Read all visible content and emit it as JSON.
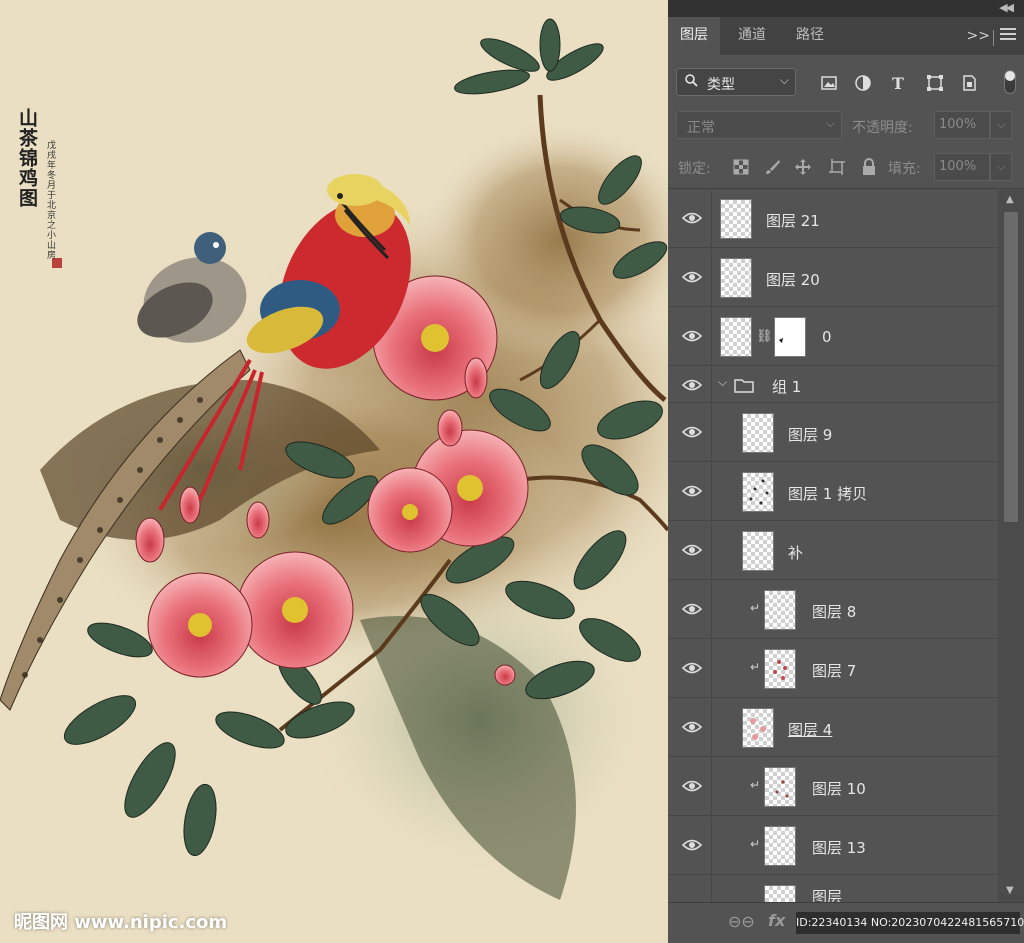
{
  "artwork": {
    "poem_title": "山茶锦鸡图",
    "poem_line": "戊戌年冬月于北京之小山房",
    "watermark": "昵图网 www.nipic.com"
  },
  "panel": {
    "tabs": [
      {
        "label": "图层",
        "active": true
      },
      {
        "label": "通道",
        "active": false
      },
      {
        "label": "路径",
        "active": false
      }
    ],
    "expand_icon": "double-chevron-right-icon",
    "menu_icon": "hamburger-menu-icon",
    "filter": {
      "label": "类型",
      "icons": [
        "image-filter-icon",
        "adjustment-filter-icon",
        "type-filter-icon",
        "shape-filter-icon",
        "smart-object-filter-icon"
      ]
    },
    "blend": {
      "mode": "正常",
      "opacity_label": "不透明度:",
      "opacity_value": "100%"
    },
    "lock": {
      "label": "锁定:",
      "icons": [
        "lock-transparent-icon",
        "lock-paint-icon",
        "lock-move-icon",
        "lock-artboard-icon",
        "lock-all-icon"
      ],
      "fill_label": "填充:",
      "fill_value": "100%"
    },
    "layers": [
      {
        "name": "图层 21",
        "indent": 0,
        "kind": "layer"
      },
      {
        "name": "图层 20",
        "indent": 0,
        "kind": "layer"
      },
      {
        "name": "0",
        "indent": 0,
        "kind": "masked"
      },
      {
        "name": "组 1",
        "indent": 0,
        "kind": "group"
      },
      {
        "name": "图层 9",
        "indent": 1,
        "kind": "layer"
      },
      {
        "name": "图层 1 拷贝",
        "indent": 1,
        "kind": "layer"
      },
      {
        "name": "补",
        "indent": 1,
        "kind": "layer"
      },
      {
        "name": "图层 8",
        "indent": 2,
        "kind": "clipped"
      },
      {
        "name": "图层 7",
        "indent": 2,
        "kind": "clipped"
      },
      {
        "name": "图层 4",
        "indent": 1,
        "kind": "layer"
      },
      {
        "name": "图层 10",
        "indent": 2,
        "kind": "clipped"
      },
      {
        "name": "图层 13",
        "indent": 2,
        "kind": "clipped"
      },
      {
        "name": "图层",
        "indent": 2,
        "kind": "clipped"
      }
    ],
    "bottom": {
      "link_icon": "link-layers-icon",
      "fx_label": "fx",
      "overlay_text": "ID:22340134 NO:20230704224815657100"
    }
  }
}
